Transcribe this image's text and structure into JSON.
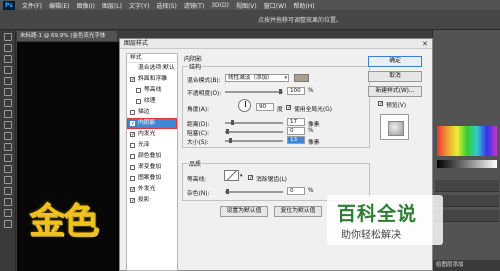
{
  "app": {
    "logo": "Ps",
    "menu": [
      "文件(F)",
      "编辑(E)",
      "图像(I)",
      "图层(L)",
      "文字(Y)",
      "选择(S)",
      "滤镜(T)",
      "3D(D)",
      "视图(V)",
      "窗口(W)",
      "帮助(H)"
    ],
    "hint": "点按并拖移可调整效果的位置。",
    "doc_tab": "未标题-1 @ 69.9% (金色流光字体",
    "canvas_text": "金色",
    "layers_label": "给图层添加"
  },
  "dialog": {
    "title": "图层样式",
    "left_header": "样式",
    "left_items": [
      {
        "label": "混合选项:默认",
        "checkbox": false,
        "checked": false
      },
      {
        "label": "斜面和浮雕",
        "checkbox": true,
        "checked": true
      },
      {
        "label": "等高线",
        "checkbox": true,
        "checked": false,
        "sub": true
      },
      {
        "label": "纹理",
        "checkbox": true,
        "checked": false,
        "sub": true
      },
      {
        "label": "描边",
        "checkbox": true,
        "checked": false
      },
      {
        "label": "内阴影",
        "checkbox": true,
        "checked": true,
        "selected": true
      },
      {
        "label": "内发光",
        "checkbox": true,
        "checked": true
      },
      {
        "label": "光泽",
        "checkbox": true,
        "checked": false
      },
      {
        "label": "颜色叠加",
        "checkbox": true,
        "checked": false
      },
      {
        "label": "渐变叠加",
        "checkbox": true,
        "checked": false
      },
      {
        "label": "图案叠加",
        "checkbox": true,
        "checked": false
      },
      {
        "label": "外发光",
        "checkbox": true,
        "checked": true
      },
      {
        "label": "投影",
        "checkbox": true,
        "checked": true
      }
    ],
    "section_title": "内阴影",
    "structure": {
      "legend": "结构",
      "blend_mode_label": "混合模式(B):",
      "blend_mode_value": "线性减淡（添加）",
      "blend_color": "#a89f93",
      "opacity_label": "不透明度(O):",
      "opacity_value": "100",
      "opacity_unit": "%",
      "opacity_level": 1.0,
      "angle_label": "角度(A):",
      "angle_value": "90",
      "angle_unit": "度",
      "global_light_label": "使用全局光(G)",
      "global_light_checked": true,
      "distance_label": "距离(D):",
      "distance_value": "17",
      "distance_unit": "像素",
      "distance_level": 0.12,
      "choke_label": "阻塞(C):",
      "choke_value": "0",
      "choke_unit": "%",
      "choke_level": 0.0,
      "size_label": "大小(S):",
      "size_value": "13",
      "size_unit": "像素",
      "size_level": 0.08
    },
    "quality": {
      "legend": "品质",
      "contour_label": "等高线:",
      "antialias_label": "消除锯齿(L)",
      "antialias_checked": true,
      "noise_label": "杂色(N):",
      "noise_value": "0",
      "noise_unit": "%",
      "noise_level": 0.0
    },
    "set_default_button": "设置为默认值",
    "reset_default_button": "复位为默认值",
    "ok_button": "确定",
    "cancel_button": "取消",
    "new_style_button": "新建样式(W)...",
    "preview_label": "预览(V)",
    "preview_checked": true
  },
  "watermark": {
    "main": "百科全说",
    "sub": "助你轻松解决"
  }
}
